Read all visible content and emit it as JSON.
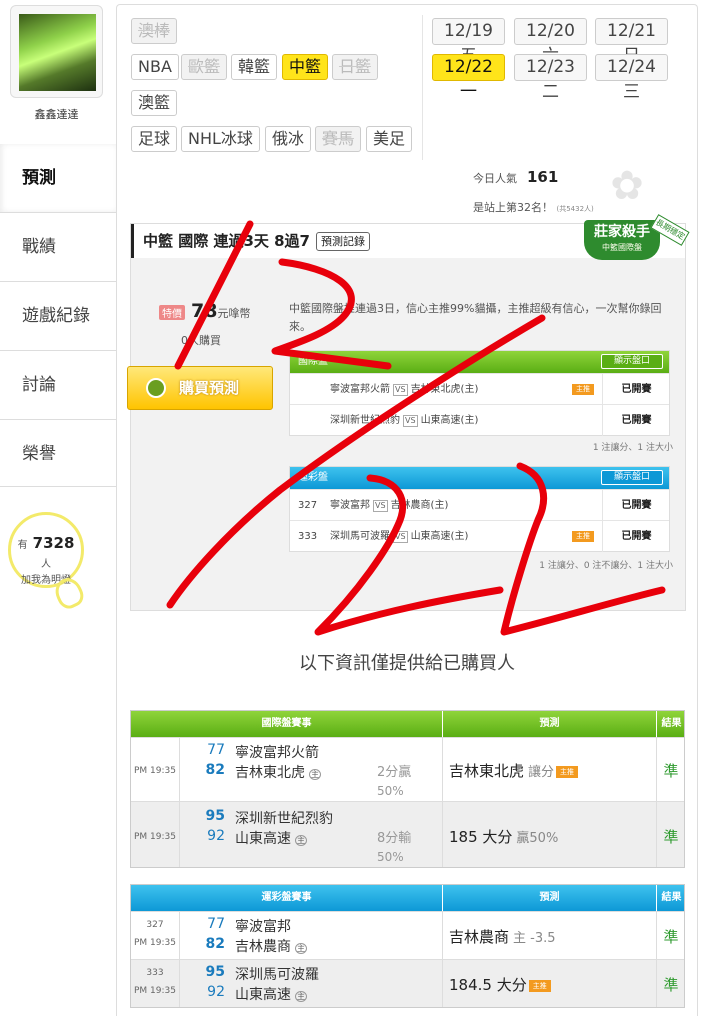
{
  "user": {
    "name": "鑫鑫達達"
  },
  "sidebar": {
    "items": [
      {
        "label": "預測"
      },
      {
        "label": "戰績"
      },
      {
        "label": "遊戲紀錄"
      },
      {
        "label": "討論"
      },
      {
        "label": "榮譽"
      }
    ]
  },
  "fans": {
    "prefix": "有",
    "count": "7328",
    "suffix": "人",
    "cta": "加我為明燈"
  },
  "sports": [
    "澳棒",
    "NBA",
    "歐籃",
    "韓籃",
    "中籃",
    "日籃",
    "澳籃",
    "足球",
    "NHL冰球",
    "俄冰",
    "賽馬",
    "美足"
  ],
  "dates": [
    {
      "md": "12/19",
      "day": "五"
    },
    {
      "md": "12/20",
      "day": "六"
    },
    {
      "md": "12/21",
      "day": "日"
    },
    {
      "md": "12/22",
      "day": "一"
    },
    {
      "md": "12/23",
      "day": "二"
    },
    {
      "md": "12/24",
      "day": "三"
    }
  ],
  "stats": {
    "popularity_label": "今日人氣",
    "popularity": "161",
    "rank": "是站上第32名！",
    "rank_note": "(共5432人)"
  },
  "prediction": {
    "title": "中籃 國際 連過3天 8過7",
    "record_button": "預測記錄",
    "badge_title": "莊家殺手",
    "badge_sub": "中籃國際盤",
    "badge_ribbon": "長期穩定",
    "price_tag": "特價",
    "price": "78",
    "price_unit": "元嗱幣",
    "buyers": "0人購買",
    "buy_button": "購買預測",
    "description": "中籃國際盤推連過3日，信心主推99%貓攝，主推超級有信心，一次幫你錄回來。",
    "show_label": "顯示盤口",
    "intl": {
      "header": "國際盤",
      "rows": [
        {
          "no": "",
          "away": "寧波富邦火箭",
          "home": "吉林東北虎(主)",
          "main": true,
          "status": "已開賽"
        },
        {
          "no": "",
          "away": "深圳新世紀烈豹",
          "home": "山東高速(主)",
          "main": false,
          "status": "已開賽"
        }
      ],
      "note": "1 注讓分、1 注大小"
    },
    "lottery": {
      "header": "運彩盤",
      "rows": [
        {
          "no": "327",
          "away": "寧波富邦",
          "home": "吉林農商(主)",
          "main": false,
          "status": "已開賽"
        },
        {
          "no": "333",
          "away": "深圳馬可波羅",
          "home": "山東高速(主)",
          "main": true,
          "status": "已開賽"
        }
      ],
      "note": "1 注讓分、0 注不讓分、1 注大小"
    }
  },
  "info_text": "以下資訊僅提供給已購買人",
  "results_intl": {
    "headers": [
      "國際盤賽事",
      "預測",
      "結果"
    ],
    "rows": [
      {
        "time": "PM 19:35",
        "s1": "77",
        "t1": "寧波富邦火箭",
        "s2": "82",
        "t2": "吉林東北虎",
        "r1": "2分贏",
        "r2": "50%",
        "pred": "吉林東北虎",
        "pred_sub": "讓分",
        "main": true,
        "result": "準"
      },
      {
        "time": "PM 19:35",
        "s1": "95",
        "t1": "深圳新世紀烈豹",
        "s2": "92",
        "t2": "山東高速",
        "r1": "8分輸",
        "r2": "50%",
        "pred": "185 大分",
        "pred_sub": "贏50%",
        "main": false,
        "result": "準"
      }
    ]
  },
  "results_lottery": {
    "headers": [
      "運彩盤賽事",
      "預測",
      "結果"
    ],
    "rows": [
      {
        "no": "327",
        "time": "PM 19:35",
        "s1": "77",
        "t1": "寧波富邦",
        "s2": "82",
        "t2": "吉林農商",
        "pred": "吉林農商",
        "pred_sub": "主 -3.5",
        "main": false,
        "result": "準"
      },
      {
        "no": "333",
        "time": "PM 19:35",
        "s1": "95",
        "t1": "深圳馬可波羅",
        "s2": "92",
        "t2": "山東高速",
        "pred": "184.5 大分",
        "pred_sub": "",
        "main": true,
        "result": "準"
      }
    ]
  },
  "main_tag": "主推",
  "home_mark": "主",
  "vs": "VS",
  "colors": {
    "accent_yellow": "#ffe41a",
    "green": "#5aae14",
    "blue": "#0d98d6",
    "scribble": "#e8000b"
  }
}
